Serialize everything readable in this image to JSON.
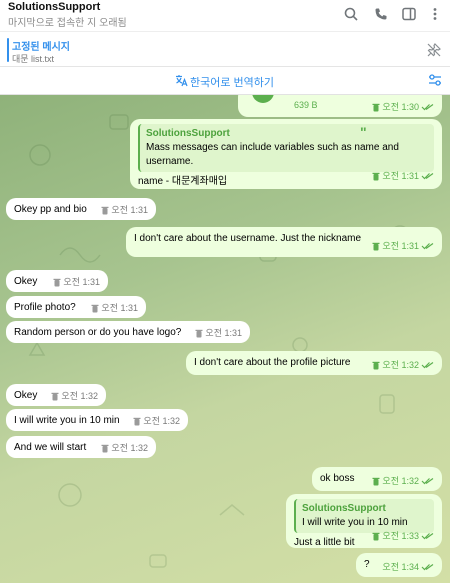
{
  "header": {
    "title": "SolutionsSupport",
    "subtitle": "마지막으로 접속한 지 오래됨",
    "icons": [
      "search-icon",
      "phone-icon",
      "sidebar-icon",
      "more-vert-icon"
    ]
  },
  "pinned": {
    "title": "고정된 메시지",
    "text": "대문 list.txt",
    "icon": "unpin-icon"
  },
  "translate": {
    "label": "한국어로 번역하기",
    "icon": "translate-icon",
    "settings_icon": "tune-icon"
  },
  "colors": {
    "accent": "#3390ec",
    "outgoing_bg": "#eeffde",
    "incoming_bg": "#ffffff",
    "outgoing_meta": "#5caf4e",
    "chat_bg_top": "#8fb27a",
    "chat_bg_bottom": "#d3dfa6"
  },
  "messages": [
    {
      "dir": "out",
      "file_size": "639 B",
      "time": "오전 1:30"
    },
    {
      "dir": "out",
      "quote_name": "SolutionsSupport",
      "quote_text": "Mass messages can include variables such as name and username.",
      "text": "name - 대문계좌매입",
      "time": "오전 1:31"
    },
    {
      "dir": "in",
      "text": "Okey pp and bio",
      "time": "오전 1:31"
    },
    {
      "dir": "out",
      "text": "I don't care about the username. Just the nickname",
      "time": "오전 1:31"
    },
    {
      "dir": "in",
      "text": "Okey",
      "time": "오전 1:31"
    },
    {
      "dir": "in",
      "text": "Profile photo?",
      "time": "오전 1:31"
    },
    {
      "dir": "in",
      "text": "Random person or do you have logo?",
      "time": "오전 1:31"
    },
    {
      "dir": "out",
      "text": "I don't care about the profile picture",
      "time": "오전 1:32"
    },
    {
      "dir": "in",
      "text": "Okey",
      "time": "오전 1:32"
    },
    {
      "dir": "in",
      "text": "I will write you in 10 min",
      "time": "오전 1:32"
    },
    {
      "dir": "in",
      "text": "And we will start",
      "time": "오전 1:32"
    },
    {
      "dir": "out",
      "text": "ok boss",
      "time": "오전 1:32"
    },
    {
      "dir": "out",
      "quote_name": "SolutionsSupport",
      "quote_text": "I will write you in 10 min",
      "text": "Just a little bit",
      "time": "오전 1:33"
    },
    {
      "dir": "out",
      "text": "?",
      "time": "오전 1:34"
    }
  ]
}
